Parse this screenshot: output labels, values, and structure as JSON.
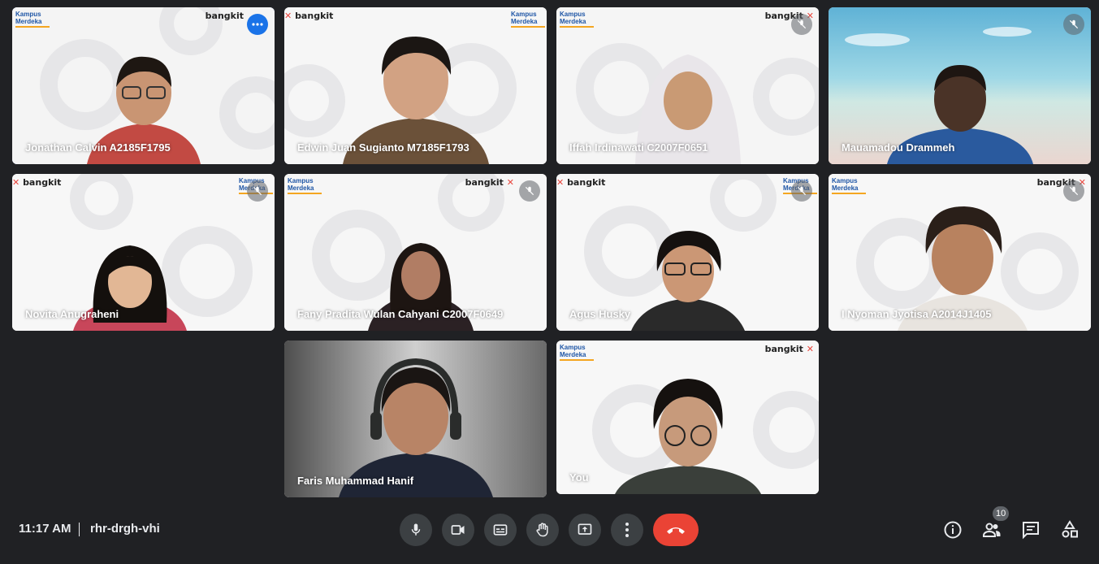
{
  "meeting": {
    "time": "11:17 AM",
    "code": "rhr-drgh-vhi",
    "participant_count": "10"
  },
  "participants": [
    {
      "name": "Jonathan Calvin A2185F1795",
      "bg": "#f4f4f4",
      "shirt": "#c24a43",
      "skin": "#c99573",
      "hair": "#1e1712"
    },
    {
      "name": "Edwin Juan Sugianto M7185F1793",
      "bg": "#f6f6f6",
      "shirt": "#6b5139",
      "skin": "#d2a283",
      "hair": "#1b1613"
    },
    {
      "name": "Iffah Irdinawati C2007F0651",
      "bg": "#f5f5f5",
      "shirt": "#e9e6ea",
      "skin": "#c99a74",
      "hair": "#efeef2"
    },
    {
      "name": "Mauamadou Drammeh",
      "bg": "#7fc6d6",
      "shirt": "#2a5a9e",
      "skin": "#4a3327",
      "hair": "#1e1612"
    },
    {
      "name": "Novita Anugraheni",
      "bg": "#f7f7f7",
      "shirt": "#c8465a",
      "skin": "#e2b795",
      "hair": "#14100d"
    },
    {
      "name": "Fany Pradita Wulan Cahyani C2007F0649",
      "bg": "#f6f6f6",
      "shirt": "#2b2124",
      "skin": "#b17d64",
      "hair": "#1d1512"
    },
    {
      "name": "Agus Husky",
      "bg": "#f7f7f7",
      "shirt": "#2a2a2a",
      "skin": "#cb9775",
      "hair": "#15110f"
    },
    {
      "name": "I Nyoman Jyotisa A2014J1405",
      "bg": "#f7f7f7",
      "shirt": "#e8e4df",
      "skin": "#b8825f",
      "hair": "#2a1f19"
    },
    {
      "name": "Faris Muhammad Hanif",
      "bg": "#8a8a8a",
      "shirt": "#1f2535",
      "skin": "#b88466",
      "hair": "#1a1513"
    },
    {
      "name": "You",
      "bg": "#f7f7f7",
      "shirt": "#3a3f3a",
      "skin": "#c79a7b",
      "hair": "#15110f"
    }
  ],
  "branding": {
    "bangkit": "bangkit",
    "kampus_line1": "Kampus",
    "kampus_line2": "Merdeka"
  },
  "colors": {
    "page_bg": "#202124",
    "control_bg": "#3c4043",
    "end_call": "#ea4335",
    "accent": "#1a73e8",
    "active_border": "#8ab4f8"
  },
  "icons": {
    "mic": "microphone-icon",
    "camera": "video-camera-icon",
    "captions": "closed-captions-icon",
    "hand": "raise-hand-icon",
    "present": "present-screen-icon",
    "more": "more-options-icon",
    "end": "end-call-icon",
    "info": "info-icon",
    "people": "people-icon",
    "chat": "chat-icon",
    "activities": "activities-icon"
  }
}
